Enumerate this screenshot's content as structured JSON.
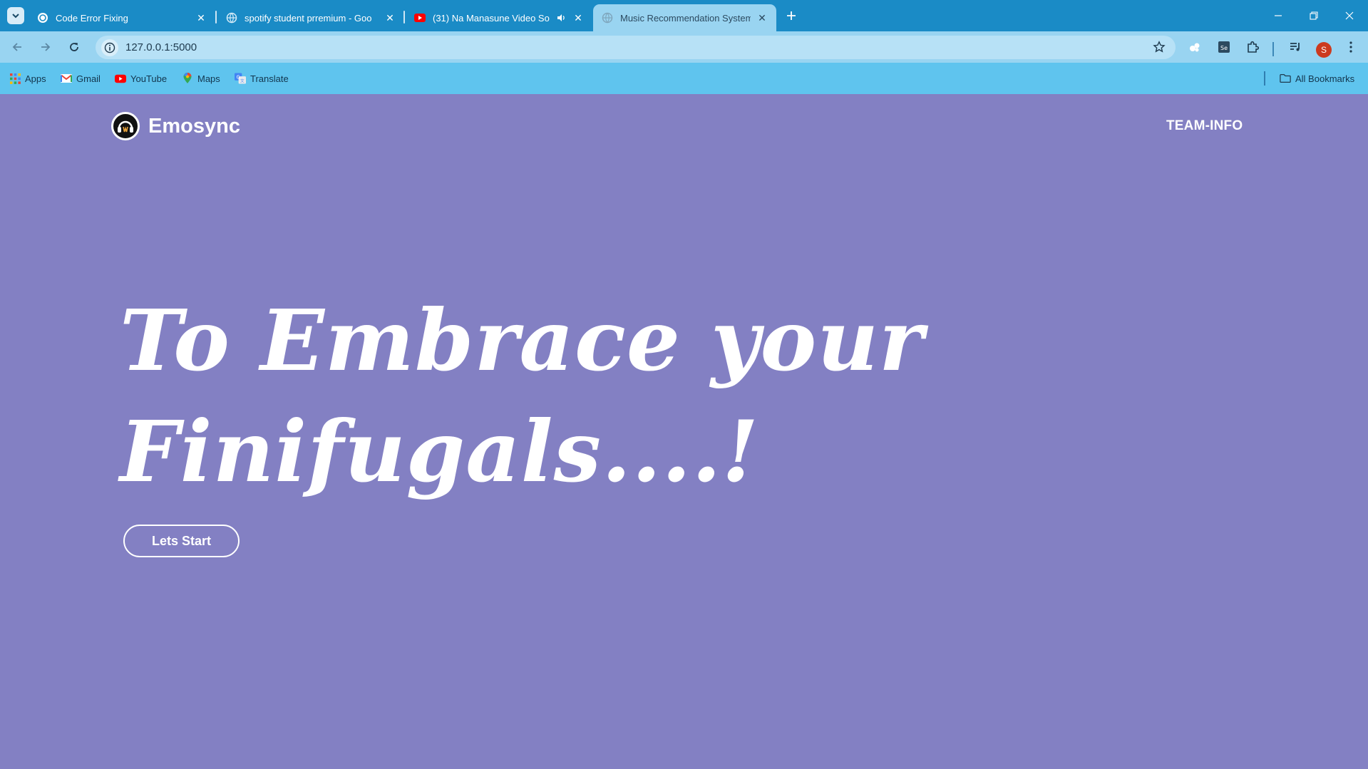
{
  "browser": {
    "tabs": [
      {
        "title": "Code Error Fixing",
        "icon": "openai-icon",
        "active": false
      },
      {
        "title": "spotify student prremium - Goo",
        "icon": "globe-icon",
        "active": false
      },
      {
        "title": "(31) Na Manasune Video So",
        "icon": "youtube-icon",
        "active": false,
        "audio": true
      },
      {
        "title": "Music Recommendation System",
        "icon": "globe-icon",
        "active": true
      }
    ],
    "url": "127.0.0.1:5000",
    "profile_initial": "S",
    "bookmarks": [
      {
        "label": "Apps",
        "icon": "apps-grid-icon"
      },
      {
        "label": "Gmail",
        "icon": "gmail-icon"
      },
      {
        "label": "YouTube",
        "icon": "youtube-icon"
      },
      {
        "label": "Maps",
        "icon": "maps-pin-icon"
      },
      {
        "label": "Translate",
        "icon": "translate-icon"
      }
    ],
    "all_bookmarks_label": "All Bookmarks",
    "colors": {
      "tabstrip": "#1a8bc6",
      "toolbar": "#99d4f1",
      "bookmarks_bar": "#5fc4ee"
    }
  },
  "site": {
    "brand": "Emosync",
    "nav_link": "TEAM-INFO",
    "hero_line1": "To Embrace your",
    "hero_line2": "Finifugals....!",
    "cta": "Lets Start",
    "background": "#8380c3"
  }
}
